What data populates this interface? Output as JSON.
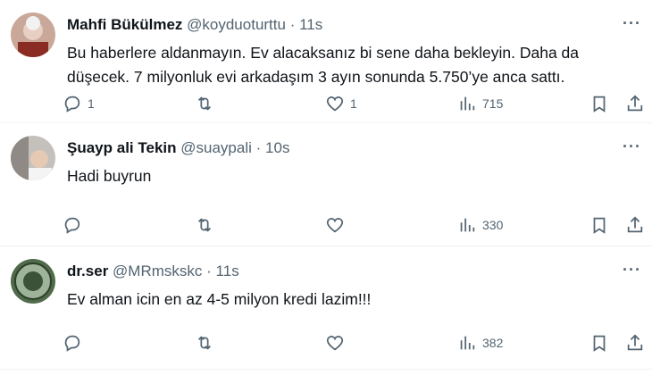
{
  "tweets": [
    {
      "name": "Mahfi Bükülmez",
      "handle": "@koyduoturttu",
      "dot": "·",
      "time": "11s",
      "text": "Bu haberlere aldanmayın. Ev alacaksanız bi sene daha bekleyin. Daha da düşecek. 7 milyonluk evi arkadaşım 3 ayın sonunda 5.750’ye anca sattı.",
      "replies": "1",
      "retweets": "",
      "likes": "1",
      "views": "715"
    },
    {
      "name": "Şuayp ali Tekin",
      "handle": "@suaypali",
      "dot": "·",
      "time": "10s",
      "text": "Hadi buyrun",
      "replies": "",
      "retweets": "",
      "likes": "",
      "views": "330"
    },
    {
      "name": "dr.ser",
      "handle": "@MRmskskc",
      "dot": "·",
      "time": "11s",
      "text": "Ev alman icin en az 4-5 milyon kredi lazim!!!",
      "replies": "",
      "retweets": "",
      "likes": "",
      "views": "382"
    }
  ],
  "more_glyph": "···"
}
